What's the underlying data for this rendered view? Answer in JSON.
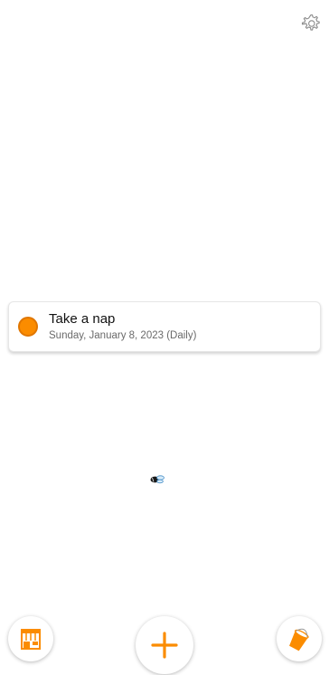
{
  "header": {
    "settings_icon": "gear-icon"
  },
  "task": {
    "title": "Take a nap",
    "subtitle": "Sunday, January 8, 2023 (Daily)",
    "check_icon": "circle-checkbox",
    "check_color": "#fb8c00"
  },
  "decor": {
    "icon": "bee-icon"
  },
  "bottom_bar": {
    "shop_icon": "shop-icon",
    "add_icon": "plus-icon",
    "paint_icon": "paint-bucket-icon",
    "accent_color": "#fb8c00"
  }
}
